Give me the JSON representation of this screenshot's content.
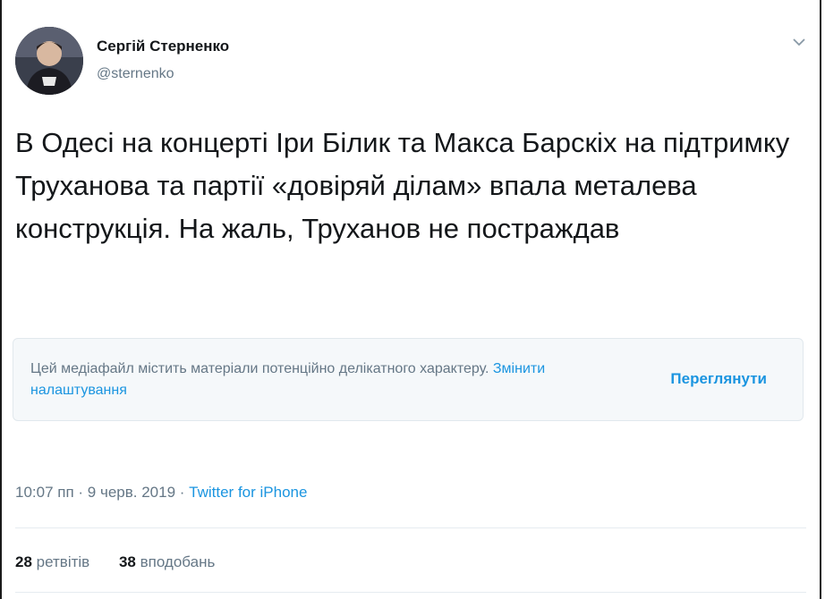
{
  "author": {
    "name": "Сергій Стерненко",
    "handle": "@sternenko"
  },
  "tweet": {
    "text": "В Одесі на концерті Іри Білик та Макса Барскіх на підтримку Труханова та партії «довіряй ділам» впала металева конструкція. На жаль, Труханов не постраждав"
  },
  "media_notice": {
    "message": "Цей медіафайл містить матеріали потенційно делікатного характеру. ",
    "change_settings": "Змінити налаштування",
    "view_button": "Переглянути"
  },
  "meta": {
    "time": "10:07 пп",
    "separator": " · ",
    "date": "9 черв. 2019",
    "source": "Twitter for iPhone"
  },
  "stats": {
    "retweets_count": "28",
    "retweets_label": "ретвітів",
    "likes_count": "38",
    "likes_label": "вподобань"
  },
  "colors": {
    "text": "#14171a",
    "secondary": "#657786",
    "link": "#1b95e0",
    "notice_bg": "#f5f8fa"
  },
  "icons": {
    "chevron": "chevron-down-icon",
    "avatar": "avatar"
  }
}
